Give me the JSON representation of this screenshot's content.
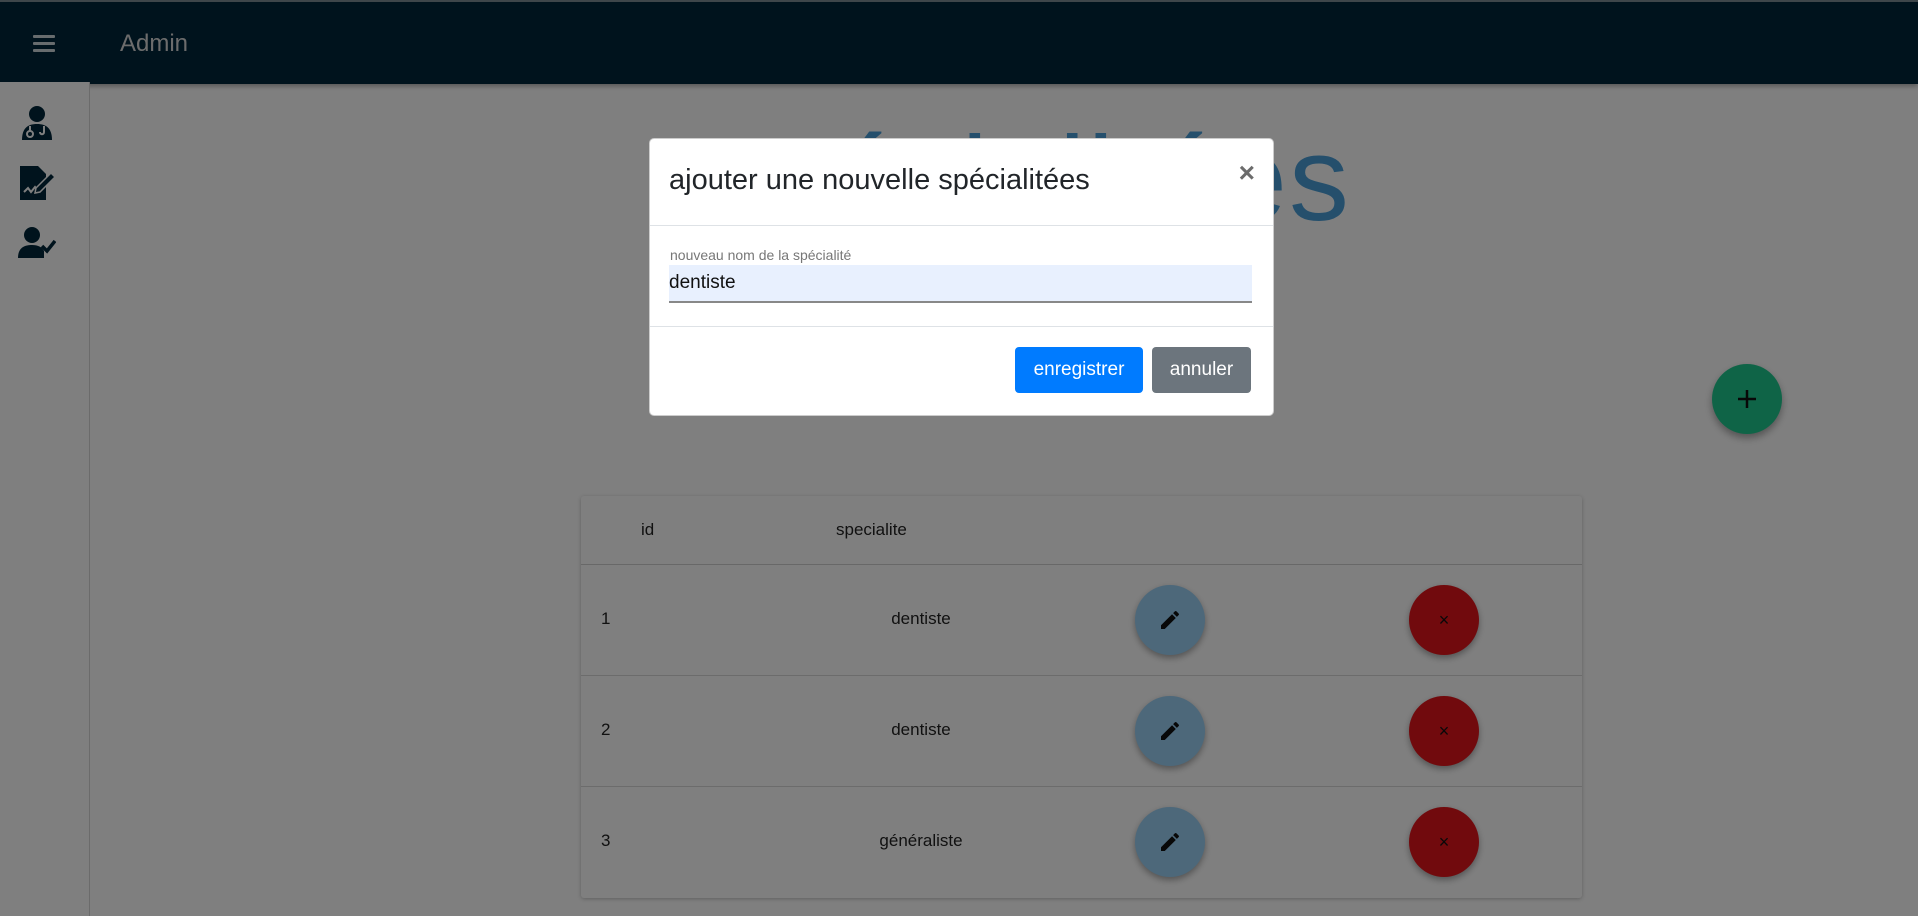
{
  "header": {
    "title": "Admin"
  },
  "page": {
    "heading": "spécialitées"
  },
  "table": {
    "columns": [
      "id",
      "specialite"
    ],
    "rows": [
      {
        "id": "1",
        "specialite": "dentiste"
      },
      {
        "id": "2",
        "specialite": "dentiste"
      },
      {
        "id": "3",
        "specialite": "généraliste"
      }
    ],
    "delete_symbol": "×"
  },
  "modal": {
    "title": "ajouter une nouvelle spécialitées",
    "close_symbol": "×",
    "field_label": "nouveau nom de la spécialité",
    "field_value": "dentiste",
    "save_label": "enregistrer",
    "cancel_label": "annuler"
  },
  "colors": {
    "topbar": "#00263a",
    "fab_add": "#1fc98f",
    "edit_button": "#9ad0f5",
    "delete_button": "#e3141a",
    "save_button": "#007bff",
    "cancel_button": "#6c757d"
  },
  "icons": {
    "menu": "menu-icon",
    "sidebar": [
      "doctor-icon",
      "signed-document-icon",
      "user-check-icon"
    ],
    "add": "plus-icon",
    "edit": "pencil-icon",
    "delete": "close-icon"
  }
}
